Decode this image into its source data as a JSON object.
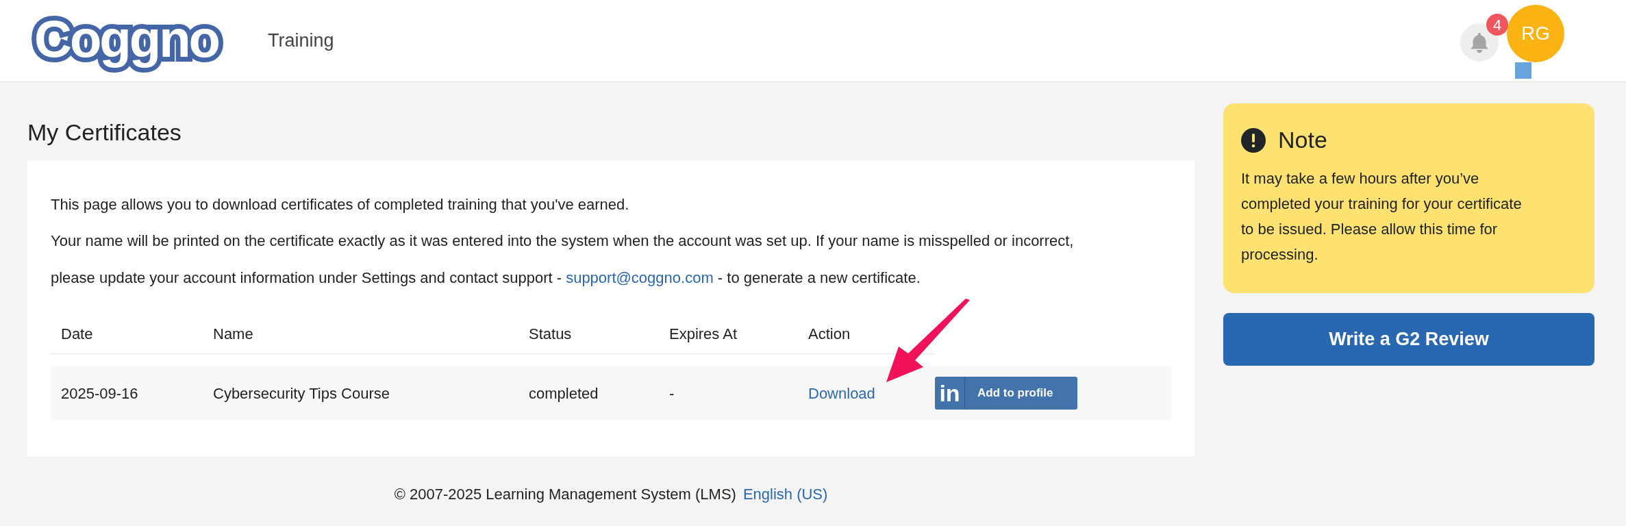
{
  "header": {
    "logo": "Coggno",
    "nav": [
      {
        "label": "Training"
      }
    ],
    "notifications": {
      "count": "4"
    },
    "avatar": {
      "initials": "RG"
    }
  },
  "page": {
    "title": "My Certificates",
    "intro": "This page allows you to download certificates of completed training that you've earned.",
    "info": {
      "before": "Your name will be printed on the certificate exactly as it was entered into the system when the account was set up. If your name is misspelled or incorrect, please update your account information under Settings and contact support - ",
      "link": "support@coggno.com",
      "after": " - to generate a new certificate."
    },
    "table": {
      "columns": [
        "Date",
        "Name",
        "Status",
        "Expires At",
        "Action"
      ],
      "rows": [
        {
          "date": "2025-09-16",
          "name": "Cybersecurity Tips Course",
          "status": "completed",
          "expires": "-",
          "action": "Download",
          "linkedin": {
            "logo": "in",
            "label": "Add to profile"
          }
        }
      ]
    }
  },
  "note": {
    "title": "Note",
    "text": "It may take a few hours after you’ve completed your training for your certificate to be issued. Please allow this time for processing."
  },
  "review_button": "Write a G2 Review",
  "footer": {
    "copyright": "© 2007-2025 Learning Management System (LMS)",
    "language": "English (US)"
  }
}
